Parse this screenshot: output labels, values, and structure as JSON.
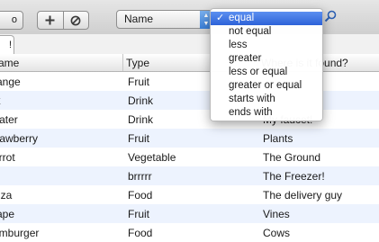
{
  "toolbar": {
    "partial_button_label": "o",
    "add_icon": "plus-icon",
    "remove_icon": "circle-slash-icon",
    "field_select_value": "Name",
    "search_icon": "magnifier-icon"
  },
  "tab": {
    "label": "!"
  },
  "table": {
    "columns": [
      "ame",
      "Type",
      "Where is it found?"
    ],
    "rows": [
      {
        "name": "range",
        "type": "Fruit",
        "location": ""
      },
      {
        "name": "lk",
        "type": "Drink",
        "location": ""
      },
      {
        "name": "Vater",
        "type": "Drink",
        "location": "My faucet!"
      },
      {
        "name": "trawberry",
        "type": "Fruit",
        "location": "Plants"
      },
      {
        "name": "arrot",
        "type": "Vegetable",
        "location": "The Ground"
      },
      {
        "name": "e",
        "type": "brrrrr",
        "location": "The Freezer!"
      },
      {
        "name": "izza",
        "type": "Food",
        "location": "The delivery guy"
      },
      {
        "name": "rape",
        "type": "Fruit",
        "location": "Vines"
      },
      {
        "name": "amburger",
        "type": "Food",
        "location": "Cows"
      }
    ]
  },
  "operator_menu": {
    "check_glyph": "✓",
    "selected": "equal",
    "items": [
      "equal",
      "not equal",
      "less",
      "greater",
      "less or equal",
      "greater or equal",
      "starts with",
      "ends with"
    ]
  },
  "colors": {
    "selection": "#3a6fe0",
    "row_alt": "#edf3fe"
  }
}
